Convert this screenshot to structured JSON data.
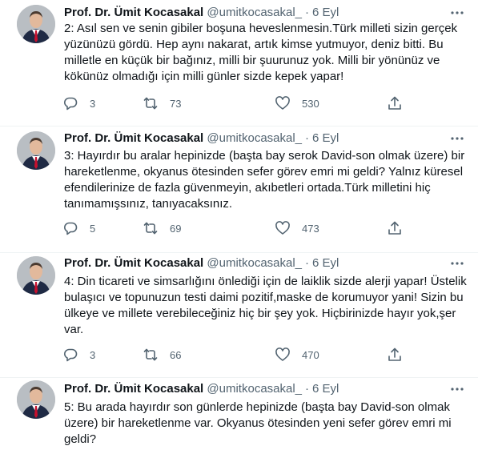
{
  "tweets": [
    {
      "author_name": "Prof. Dr. Ümit Kocasakal",
      "handle": "@umitkocasakal_",
      "separator": "·",
      "date": "6 Eyl",
      "text": "2: Asıl sen ve senin gibiler boşuna heveslenmesin.Türk milleti sizin gerçek yüzünüzü gördü. Hep aynı nakarat, artık kimse yutmuyor, deniz bitti. Bu milletle en küçük bir bağınız, milli bir şuurunuz yok. Milli bir yönünüz ve kökünüz  olmadığı için milli günler sizde kepek yapar!",
      "replies": "3",
      "retweets": "73",
      "likes": "530"
    },
    {
      "author_name": "Prof. Dr. Ümit Kocasakal",
      "handle": "@umitkocasakal_",
      "separator": "·",
      "date": "6 Eyl",
      "text": "3: Hayırdır bu aralar hepinizde (başta bay serok David-son olmak üzere) bir hareketlenme, okyanus ötesinden sefer görev emri mi geldi? Yalnız küresel efendilerinize de fazla güvenmeyin, akıbetleri ortada.Türk milletini hiç tanımamışsınız, tanıyacaksınız.",
      "replies": "5",
      "retweets": "69",
      "likes": "473"
    },
    {
      "author_name": "Prof. Dr. Ümit Kocasakal",
      "handle": "@umitkocasakal_",
      "separator": "·",
      "date": "6 Eyl",
      "text": "4: Din ticareti ve simsarlığını önlediği için de laiklik sizde alerji yapar! Üstelik bulaşıcı ve topunuzun testi daimi pozitif,maske de korumuyor yani! Sizin bu ülkeye ve millete verebileceğiniz hiç bir şey yok. Hiçbirinizde hayır yok,şer var.",
      "replies": "3",
      "retweets": "66",
      "likes": "470"
    },
    {
      "author_name": "Prof. Dr. Ümit Kocasakal",
      "handle": "@umitkocasakal_",
      "separator": "·",
      "date": "6 Eyl",
      "text": "5: Bu arada hayırdır son günlerde  hepinizde (başta bay David-son olmak üzere) bir hareketlenme var. Okyanus ötesinden yeni sefer görev emri mi geldi?",
      "replies": "",
      "retweets": "",
      "likes": ""
    }
  ],
  "colors": {
    "text": "#0f1419",
    "secondary": "#536471",
    "divider": "#eff3f4",
    "tie": "#c8102e",
    "suit": "#1f2a44"
  },
  "icons": [
    "avatar",
    "more-options-icon",
    "reply-icon",
    "retweet-icon",
    "like-icon",
    "share-icon"
  ]
}
